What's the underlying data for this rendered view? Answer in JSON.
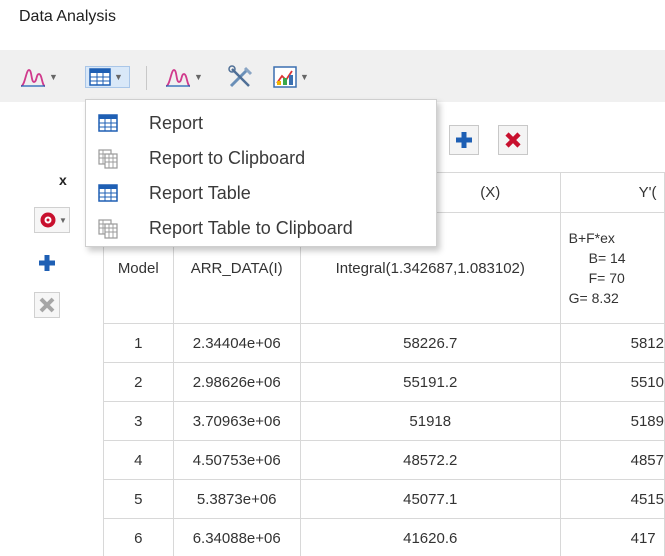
{
  "window": {
    "title": "Data Analysis"
  },
  "toolbar": {
    "buttons": [
      {
        "icon": "peak-curve-icon",
        "has_dropdown": true
      },
      {
        "icon": "table-grid-icon",
        "has_dropdown": true,
        "active": true
      },
      {
        "icon": "peak-curve-icon",
        "has_dropdown": true
      },
      {
        "icon": "tools-icon",
        "has_dropdown": false
      },
      {
        "icon": "chart-image-icon",
        "has_dropdown": true
      }
    ]
  },
  "menu": {
    "items": [
      {
        "label": "Report",
        "icon": "table-icon",
        "enabled": true
      },
      {
        "label": "Report to Clipboard",
        "icon": "clipboard-table-icon",
        "enabled": true
      },
      {
        "label": "Report Table",
        "icon": "table-icon",
        "enabled": true
      },
      {
        "label": "Report Table to Clipboard",
        "icon": "clipboard-table-icon",
        "enabled": true
      }
    ]
  },
  "side_panel": {
    "label": "x",
    "buttons": [
      "settings-icon",
      "add-icon",
      "remove-icon"
    ]
  },
  "table_toolbar": {
    "buttons": [
      "add-icon",
      "delete-icon"
    ]
  },
  "table": {
    "header": {
      "col2": "(X)",
      "col3": "Y'("
    },
    "model_row": {
      "label": "Model",
      "col1": "ARR_DATA(I)",
      "col2": "Integral(1.342687,1.083102)",
      "col3_lines": [
        "B+F*ex",
        "B= 14",
        "F= 70",
        "G= 8.32"
      ]
    },
    "rows": [
      {
        "index": "1",
        "arr": "2.34404e+06",
        "integral": "58226.7",
        "y": "5812"
      },
      {
        "index": "2",
        "arr": "2.98626e+06",
        "integral": "55191.2",
        "y": "5510"
      },
      {
        "index": "3",
        "arr": "3.70963e+06",
        "integral": "51918",
        "y": "5189"
      },
      {
        "index": "4",
        "arr": "4.50753e+06",
        "integral": "48572.2",
        "y": "4857"
      },
      {
        "index": "5",
        "arr": "5.3873e+06",
        "integral": "45077.1",
        "y": "4515"
      },
      {
        "index": "6",
        "arr": "6.34088e+06",
        "integral": "41620.6",
        "y": "417"
      }
    ]
  },
  "colors": {
    "accent_blue": "#1e5fb4",
    "delete_red": "#c8102e",
    "menu_border": "#cfcfcf",
    "toolbar_bg": "#f0f0f0"
  }
}
